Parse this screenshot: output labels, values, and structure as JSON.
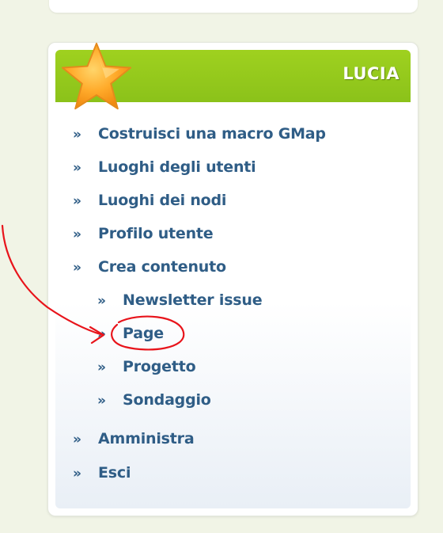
{
  "block": {
    "title": "LUCIA",
    "header_color": "#93c91c",
    "link_color": "#2f5d86",
    "annotation_color": "#e8141b"
  },
  "icons": {
    "star": "star-icon",
    "bullet": "»"
  },
  "menu": {
    "items": [
      {
        "label": "Costruisci una macro GMap"
      },
      {
        "label": "Luoghi degli utenti"
      },
      {
        "label": "Luoghi dei nodi"
      },
      {
        "label": "Profilo utente"
      },
      {
        "label": "Crea contenuto"
      },
      {
        "label": "Newsletter issue"
      },
      {
        "label": "Page"
      },
      {
        "label": "Progetto"
      },
      {
        "label": "Sondaggio"
      },
      {
        "label": "Amministra"
      },
      {
        "label": "Esci"
      }
    ]
  }
}
